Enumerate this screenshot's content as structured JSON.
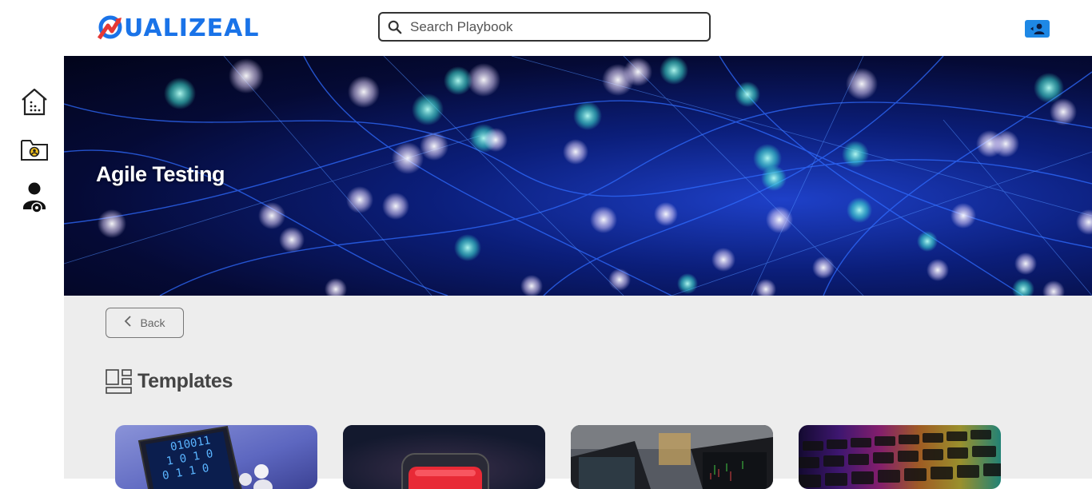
{
  "brand": {
    "logo_text": "QUALIZEAL",
    "accent": "#1a73e8",
    "mark_color": "#e53935"
  },
  "search": {
    "placeholder": "Search Playbook",
    "value": ""
  },
  "header": {
    "user_button_icon": "user-switch-icon"
  },
  "sidebar": {
    "items": [
      {
        "name": "home",
        "icon": "home-icon"
      },
      {
        "name": "folder-user",
        "icon": "folder-user-icon"
      },
      {
        "name": "user-settings",
        "icon": "user-settings-icon"
      }
    ]
  },
  "hero": {
    "title": "Agile Testing"
  },
  "back": {
    "label": "Back"
  },
  "templates": {
    "title": "Templates",
    "cards": [
      {
        "name": "template-binary-laptop"
      },
      {
        "name": "template-red-device"
      },
      {
        "name": "template-trading-screens"
      },
      {
        "name": "template-rgb-keyboard"
      }
    ]
  }
}
